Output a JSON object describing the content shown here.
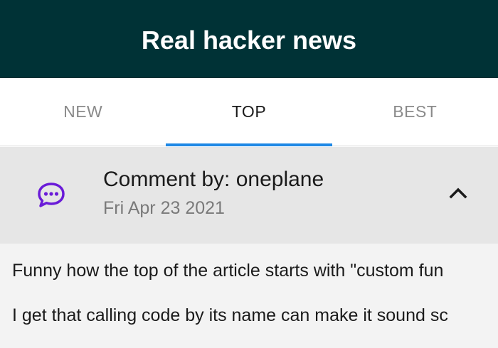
{
  "app": {
    "title": "Real hacker news"
  },
  "tabs": [
    {
      "label": "NEW",
      "active": false
    },
    {
      "label": "TOP",
      "active": true
    },
    {
      "label": "BEST",
      "active": false
    }
  ],
  "comment": {
    "author_line": "Comment by: oneplane",
    "date": "Fri Apr 23 2021",
    "icon": "comment-dots-icon",
    "collapse_icon": "chevron-up-icon",
    "paragraphs": [
      "Funny how the top of the article starts with \"custom fun",
      "I get that calling code by its name can make it sound sc"
    ]
  },
  "colors": {
    "app_bar": "#003236",
    "tab_indicator": "#1e88e5",
    "comment_icon": "#6a1bd8",
    "header_bg": "#e6e6e6",
    "body_bg": "#f3f3f3"
  }
}
